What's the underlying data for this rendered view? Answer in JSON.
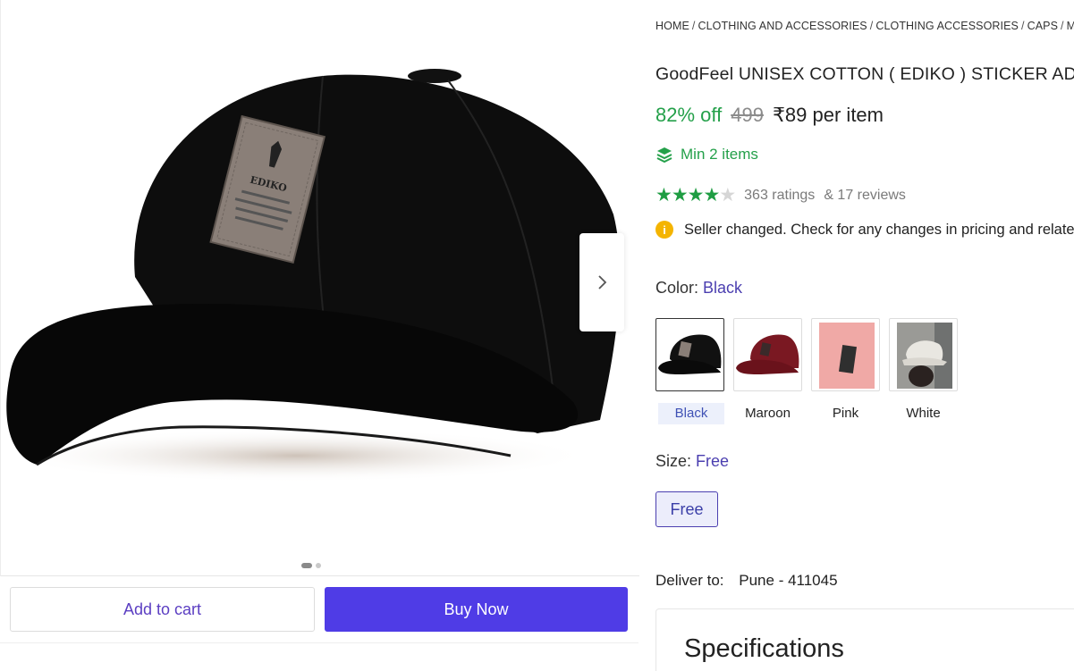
{
  "breadcrumb": [
    "HOME",
    "CLOTHING AND ACCESSORIES",
    "CLOTHING ACCESSORIES",
    "CAPS",
    "M"
  ],
  "product": {
    "title": "GoodFeel UNISEX COTTON ( EDIKO ) STICKER ADJUSTABLE CAP",
    "discount": "82% off",
    "mrp": "499",
    "price": "₹89 per item",
    "min_order": "Min 2 items",
    "rating_value": 4,
    "rating_max": 5,
    "ratings": "363 ratings",
    "reviews": "& 17 reviews",
    "notice": "Seller changed. Check for any changes in pricing and related details"
  },
  "color": {
    "label": "Color:",
    "selected": "Black",
    "options": [
      "Black",
      "Maroon",
      "Pink",
      "White"
    ]
  },
  "size": {
    "label": "Size:",
    "selected": "Free",
    "options": [
      "Free"
    ]
  },
  "delivery": {
    "label": "Deliver to:",
    "location": "Pune - 411045"
  },
  "specifications": {
    "title": "Specifications"
  },
  "actions": {
    "add_to_cart": "Add to cart",
    "buy_now": "Buy Now"
  },
  "gallery": {
    "image_count": 2,
    "current_index": 1
  },
  "colors": {
    "accent": "#4f3ce6",
    "discount_green": "#24a04a",
    "star_green": "#1f9d43",
    "info_yellow": "#f4b400"
  }
}
